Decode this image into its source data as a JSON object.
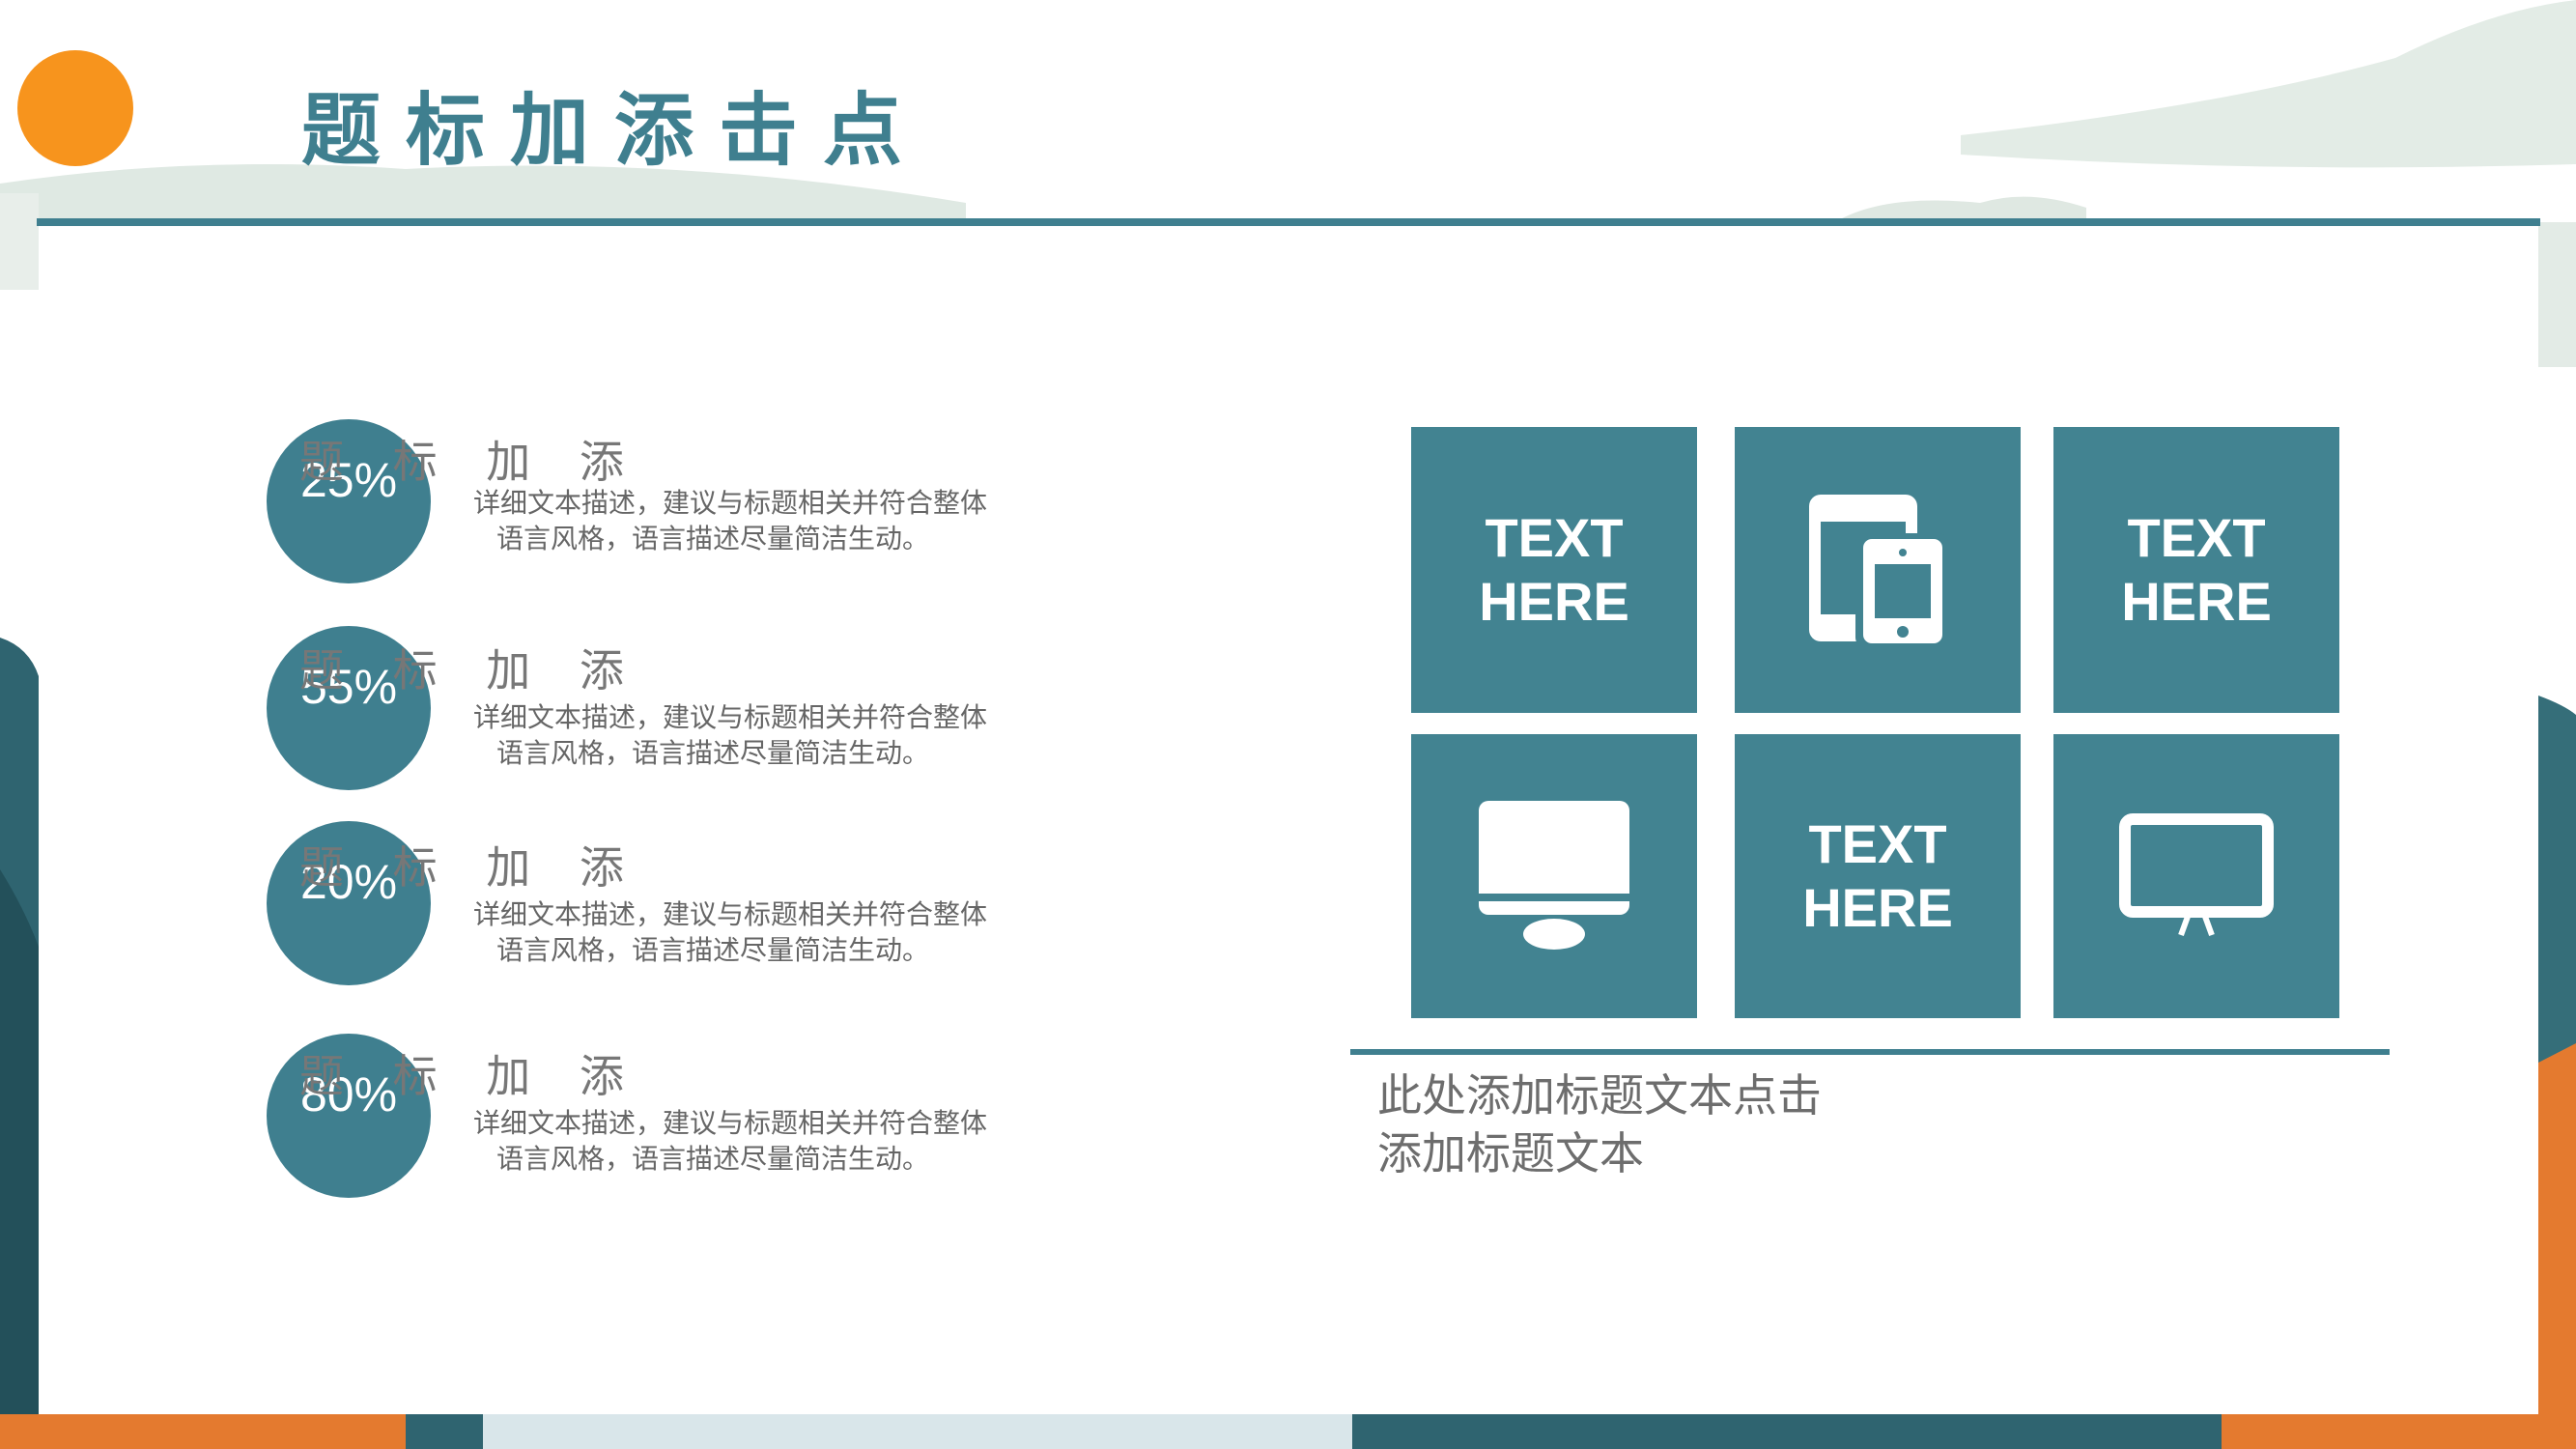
{
  "slide": {
    "title": "题标加添击点",
    "items": [
      {
        "percent": "25%",
        "title": "题 标 加 添",
        "desc": "详细文本描述，建议与标题相关并符合整体语言风格，语言描述尽量简洁生动。"
      },
      {
        "percent": "55%",
        "title": "题 标 加 添",
        "desc": "详细文本描述，建议与标题相关并符合整体语言风格，语言描述尽量简洁生动。"
      },
      {
        "percent": "20%",
        "title": "题 标 加 添",
        "desc": "详细文本描述，建议与标题相关并符合整体语言风格，语言描述尽量简洁生动。"
      },
      {
        "percent": "80%",
        "title": "题 标 加 添",
        "desc": "详细文本描述，建议与标题相关并符合整体语言风格，语言描述尽量简洁生动。"
      }
    ],
    "tiles": [
      {
        "type": "text",
        "text": "TEXT HERE"
      },
      {
        "type": "icon",
        "icon": "devices-icon"
      },
      {
        "type": "text",
        "text": "TEXT HERE"
      },
      {
        "type": "icon",
        "icon": "monitor-icon"
      },
      {
        "type": "text",
        "text": "TEXT HERE"
      },
      {
        "type": "icon",
        "icon": "presentation-screen-icon"
      }
    ],
    "caption": "此处添加标题文本点击添加标题文本",
    "colors": {
      "accent": "#3f7f8f",
      "tile": "#428391",
      "sun": "#f7941d",
      "text": "#6d6d6d"
    }
  }
}
